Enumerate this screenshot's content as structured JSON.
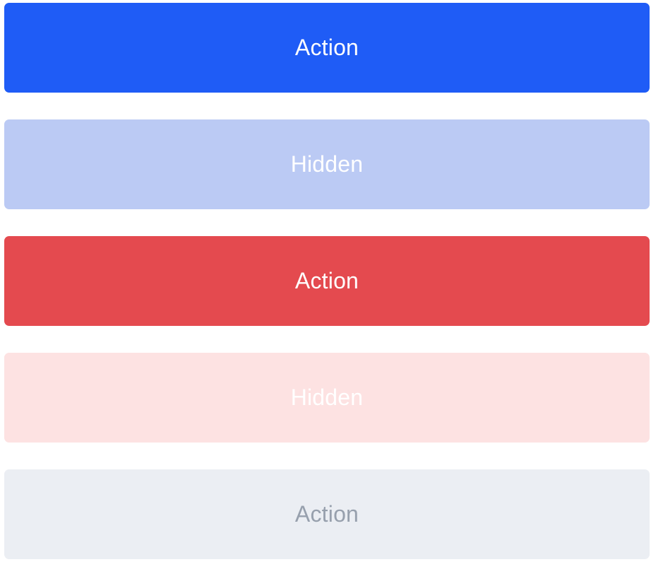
{
  "buttons": [
    {
      "label": "Action",
      "variant": "primary",
      "color": "#1f5cf6",
      "text_color": "#ffffff"
    },
    {
      "label": "Hidden",
      "variant": "primary-soft",
      "color": "#bbcaf4",
      "text_color": "#ffffff"
    },
    {
      "label": "Action",
      "variant": "danger",
      "color": "#e44a4f",
      "text_color": "#ffffff"
    },
    {
      "label": "Hidden",
      "variant": "danger-soft",
      "color": "#fde2e2",
      "text_color": "#ffffff"
    },
    {
      "label": "Action",
      "variant": "neutral",
      "color": "#ebeef3",
      "text_color": "#97a0ad"
    }
  ]
}
